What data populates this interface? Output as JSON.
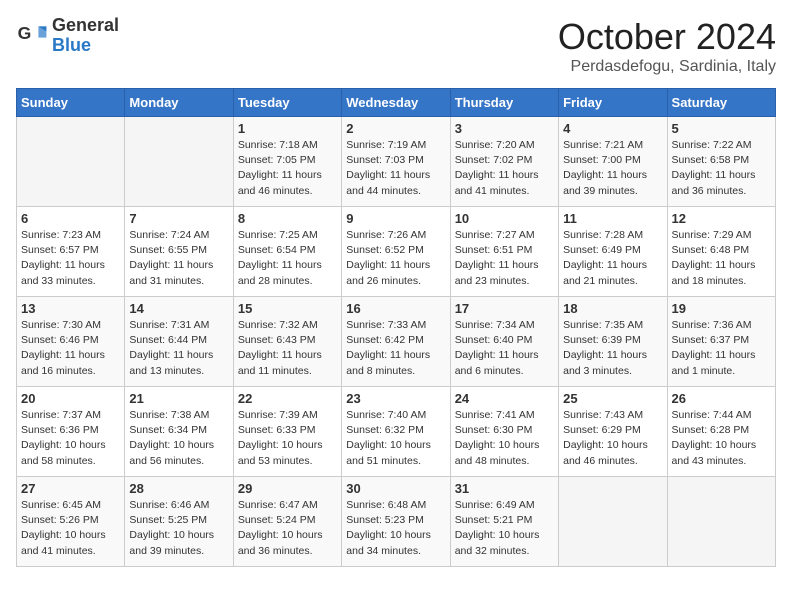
{
  "header": {
    "logo_general": "General",
    "logo_blue": "Blue",
    "month_title": "October 2024",
    "subtitle": "Perdasdefogu, Sardinia, Italy"
  },
  "weekdays": [
    "Sunday",
    "Monday",
    "Tuesday",
    "Wednesday",
    "Thursday",
    "Friday",
    "Saturday"
  ],
  "weeks": [
    [
      {
        "day": "",
        "info": ""
      },
      {
        "day": "",
        "info": ""
      },
      {
        "day": "1",
        "info": "Sunrise: 7:18 AM\nSunset: 7:05 PM\nDaylight: 11 hours and 46 minutes."
      },
      {
        "day": "2",
        "info": "Sunrise: 7:19 AM\nSunset: 7:03 PM\nDaylight: 11 hours and 44 minutes."
      },
      {
        "day": "3",
        "info": "Sunrise: 7:20 AM\nSunset: 7:02 PM\nDaylight: 11 hours and 41 minutes."
      },
      {
        "day": "4",
        "info": "Sunrise: 7:21 AM\nSunset: 7:00 PM\nDaylight: 11 hours and 39 minutes."
      },
      {
        "day": "5",
        "info": "Sunrise: 7:22 AM\nSunset: 6:58 PM\nDaylight: 11 hours and 36 minutes."
      }
    ],
    [
      {
        "day": "6",
        "info": "Sunrise: 7:23 AM\nSunset: 6:57 PM\nDaylight: 11 hours and 33 minutes."
      },
      {
        "day": "7",
        "info": "Sunrise: 7:24 AM\nSunset: 6:55 PM\nDaylight: 11 hours and 31 minutes."
      },
      {
        "day": "8",
        "info": "Sunrise: 7:25 AM\nSunset: 6:54 PM\nDaylight: 11 hours and 28 minutes."
      },
      {
        "day": "9",
        "info": "Sunrise: 7:26 AM\nSunset: 6:52 PM\nDaylight: 11 hours and 26 minutes."
      },
      {
        "day": "10",
        "info": "Sunrise: 7:27 AM\nSunset: 6:51 PM\nDaylight: 11 hours and 23 minutes."
      },
      {
        "day": "11",
        "info": "Sunrise: 7:28 AM\nSunset: 6:49 PM\nDaylight: 11 hours and 21 minutes."
      },
      {
        "day": "12",
        "info": "Sunrise: 7:29 AM\nSunset: 6:48 PM\nDaylight: 11 hours and 18 minutes."
      }
    ],
    [
      {
        "day": "13",
        "info": "Sunrise: 7:30 AM\nSunset: 6:46 PM\nDaylight: 11 hours and 16 minutes."
      },
      {
        "day": "14",
        "info": "Sunrise: 7:31 AM\nSunset: 6:44 PM\nDaylight: 11 hours and 13 minutes."
      },
      {
        "day": "15",
        "info": "Sunrise: 7:32 AM\nSunset: 6:43 PM\nDaylight: 11 hours and 11 minutes."
      },
      {
        "day": "16",
        "info": "Sunrise: 7:33 AM\nSunset: 6:42 PM\nDaylight: 11 hours and 8 minutes."
      },
      {
        "day": "17",
        "info": "Sunrise: 7:34 AM\nSunset: 6:40 PM\nDaylight: 11 hours and 6 minutes."
      },
      {
        "day": "18",
        "info": "Sunrise: 7:35 AM\nSunset: 6:39 PM\nDaylight: 11 hours and 3 minutes."
      },
      {
        "day": "19",
        "info": "Sunrise: 7:36 AM\nSunset: 6:37 PM\nDaylight: 11 hours and 1 minute."
      }
    ],
    [
      {
        "day": "20",
        "info": "Sunrise: 7:37 AM\nSunset: 6:36 PM\nDaylight: 10 hours and 58 minutes."
      },
      {
        "day": "21",
        "info": "Sunrise: 7:38 AM\nSunset: 6:34 PM\nDaylight: 10 hours and 56 minutes."
      },
      {
        "day": "22",
        "info": "Sunrise: 7:39 AM\nSunset: 6:33 PM\nDaylight: 10 hours and 53 minutes."
      },
      {
        "day": "23",
        "info": "Sunrise: 7:40 AM\nSunset: 6:32 PM\nDaylight: 10 hours and 51 minutes."
      },
      {
        "day": "24",
        "info": "Sunrise: 7:41 AM\nSunset: 6:30 PM\nDaylight: 10 hours and 48 minutes."
      },
      {
        "day": "25",
        "info": "Sunrise: 7:43 AM\nSunset: 6:29 PM\nDaylight: 10 hours and 46 minutes."
      },
      {
        "day": "26",
        "info": "Sunrise: 7:44 AM\nSunset: 6:28 PM\nDaylight: 10 hours and 43 minutes."
      }
    ],
    [
      {
        "day": "27",
        "info": "Sunrise: 6:45 AM\nSunset: 5:26 PM\nDaylight: 10 hours and 41 minutes."
      },
      {
        "day": "28",
        "info": "Sunrise: 6:46 AM\nSunset: 5:25 PM\nDaylight: 10 hours and 39 minutes."
      },
      {
        "day": "29",
        "info": "Sunrise: 6:47 AM\nSunset: 5:24 PM\nDaylight: 10 hours and 36 minutes."
      },
      {
        "day": "30",
        "info": "Sunrise: 6:48 AM\nSunset: 5:23 PM\nDaylight: 10 hours and 34 minutes."
      },
      {
        "day": "31",
        "info": "Sunrise: 6:49 AM\nSunset: 5:21 PM\nDaylight: 10 hours and 32 minutes."
      },
      {
        "day": "",
        "info": ""
      },
      {
        "day": "",
        "info": ""
      }
    ]
  ]
}
